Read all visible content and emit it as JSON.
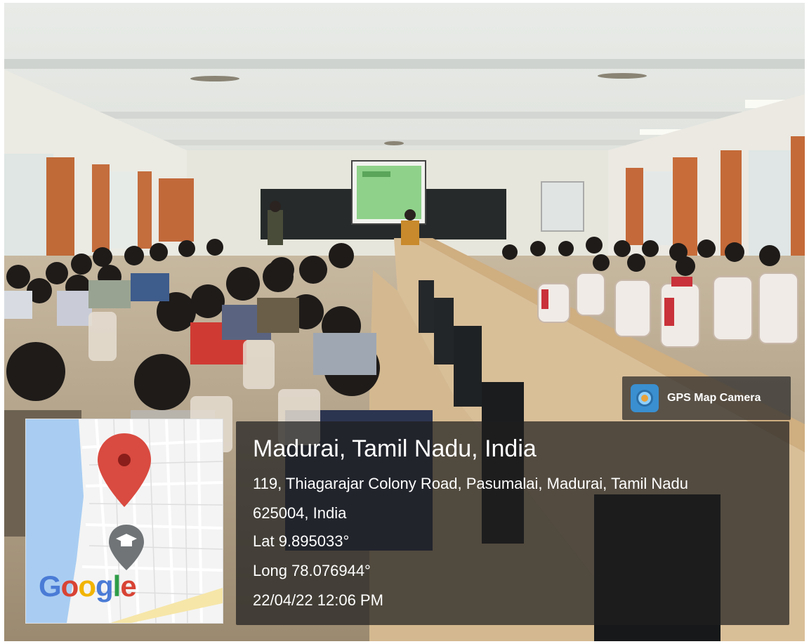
{
  "overlay": {
    "app_label": "GPS Map Camera",
    "app_icon": "gps-map-camera-icon",
    "location_title": "Madurai, Tamil Nadu, India",
    "address_line1": "119, Thiagarajar Colony Road, Pasumalai, Madurai, Tamil Nadu",
    "address_line2": "625004, India",
    "latitude": "Lat 9.895033°",
    "longitude": "Long 78.076944°",
    "datetime": "22/04/22 12:06 PM"
  },
  "map": {
    "logo_text": "Google",
    "pin_icon": "map-pin-icon",
    "place_icon": "graduation-cap-pin-icon",
    "water_color": "#a9cdf2",
    "pin_color": "#d94a40"
  }
}
